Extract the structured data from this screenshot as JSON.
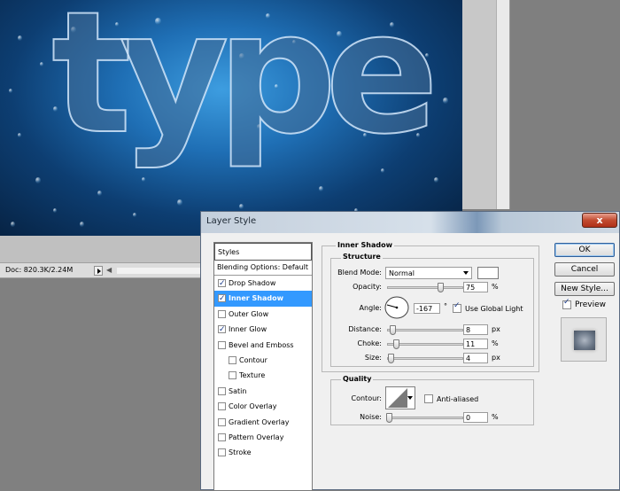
{
  "canvas": {
    "text": "type"
  },
  "status_bar": {
    "doc_size": "Doc: 820.3K/2.24M"
  },
  "dialog": {
    "title": "Layer Style",
    "close_label": "x"
  },
  "styles_panel": {
    "header": "Styles",
    "blending_options": "Blending Options: Default",
    "items": [
      {
        "label": "Drop Shadow",
        "checked": true,
        "selected": false,
        "indent": false
      },
      {
        "label": "Inner Shadow",
        "checked": true,
        "selected": true,
        "indent": false
      },
      {
        "label": "Outer Glow",
        "checked": false,
        "selected": false,
        "indent": false
      },
      {
        "label": "Inner Glow",
        "checked": true,
        "selected": false,
        "indent": false
      },
      {
        "label": "Bevel and Emboss",
        "checked": false,
        "selected": false,
        "indent": false
      },
      {
        "label": "Contour",
        "checked": false,
        "selected": false,
        "indent": true
      },
      {
        "label": "Texture",
        "checked": false,
        "selected": false,
        "indent": true
      },
      {
        "label": "Satin",
        "checked": false,
        "selected": false,
        "indent": false
      },
      {
        "label": "Color Overlay",
        "checked": false,
        "selected": false,
        "indent": false
      },
      {
        "label": "Gradient Overlay",
        "checked": false,
        "selected": false,
        "indent": false
      },
      {
        "label": "Pattern Overlay",
        "checked": false,
        "selected": false,
        "indent": false
      },
      {
        "label": "Stroke",
        "checked": false,
        "selected": false,
        "indent": false
      }
    ]
  },
  "inner_shadow": {
    "title": "Inner Shadow",
    "structure": {
      "title": "Structure",
      "blend_mode_label": "Blend Mode:",
      "blend_mode_value": "Normal",
      "shadow_color": "#ffffff",
      "opacity_label": "Opacity:",
      "opacity_value": "75",
      "opacity_unit": "%",
      "angle_label": "Angle:",
      "angle_value": "-167",
      "angle_unit": "°",
      "use_global_light_label": "Use Global Light",
      "use_global_light": true,
      "distance_label": "Distance:",
      "distance_value": "8",
      "distance_unit": "px",
      "choke_label": "Choke:",
      "choke_value": "11",
      "choke_unit": "%",
      "size_label": "Size:",
      "size_value": "4",
      "size_unit": "px"
    },
    "quality": {
      "title": "Quality",
      "contour_label": "Contour:",
      "anti_aliased_label": "Anti-aliased",
      "anti_aliased": false,
      "noise_label": "Noise:",
      "noise_value": "0",
      "noise_unit": "%"
    }
  },
  "buttons": {
    "ok": "OK",
    "cancel": "Cancel",
    "new_style": "New Style...",
    "preview_label": "Preview",
    "preview": true
  }
}
